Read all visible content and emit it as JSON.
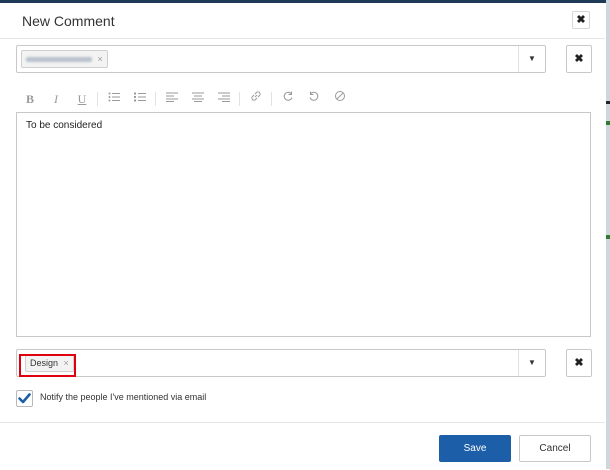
{
  "dialog": {
    "title": "New Comment",
    "close_icon_glyph": "✖"
  },
  "mentions": {
    "chip_remove": "×",
    "dropdown_glyph": "▼",
    "clear_glyph": "✖"
  },
  "toolbar": {
    "bold": "B",
    "italic": "I",
    "underline": "U",
    "bullet_list_icon": "bulleted-list-icon",
    "numbered_list_icon": "numbered-list-icon",
    "align_left_icon": "align-left-icon",
    "align_center_icon": "align-center-icon",
    "align_right_icon": "align-right-icon",
    "link_icon": "link-icon",
    "redo_icon": "redo-icon",
    "undo_icon": "undo-icon",
    "clear_format_icon": "clear-format-icon"
  },
  "editor": {
    "text": "To be considered"
  },
  "tags": {
    "chip_label": "Design",
    "chip_remove": "×",
    "dropdown_glyph": "▼",
    "clear_glyph": "✖"
  },
  "notify": {
    "label": "Notify the people I've mentioned via email",
    "checked": true,
    "check_color": "#1d5ea8"
  },
  "footer": {
    "save_label": "Save",
    "cancel_label": "Cancel"
  },
  "colors": {
    "primary": "#1d5ea8",
    "highlight_border": "#e1000f"
  }
}
